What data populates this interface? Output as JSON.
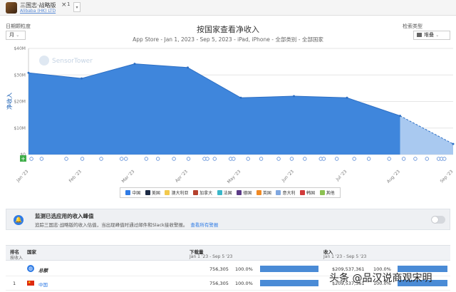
{
  "app": {
    "name": "三国志·战略版",
    "publisher": "Alibaba (HK) LTD",
    "close": "×",
    "count": "1",
    "caret": "▾"
  },
  "controls": {
    "granularity_label": "日期颗粒度",
    "granularity_value": "月",
    "view_label": "检索类型",
    "view_value": "堆叠"
  },
  "chart_data": {
    "type": "area",
    "title": "按国家查看净收入",
    "subtitle": "App Store - Jan 1, 2023 - Sep 5, 2023 - iPad, iPhone - 全部类别 - 全部国家",
    "ylabel": "净收入",
    "yticks": [
      "$0",
      "$10M",
      "$20M",
      "$30M",
      "$40M"
    ],
    "ylim": [
      0,
      40
    ],
    "unit": "$M",
    "categories": [
      "Jan '23",
      "Feb '23",
      "Mar '23",
      "Apr '23",
      "May '23",
      "Jun '23",
      "Jul '23",
      "Aug '23",
      "Sep '23"
    ],
    "series": [
      {
        "name": "中国",
        "values": [
          30.8,
          28.7,
          34.2,
          32.8,
          21.4,
          22.0,
          21.4,
          14.6,
          4.0
        ],
        "projected_from_index": 7
      }
    ],
    "watermark": "SensorTower",
    "grid": true,
    "legend_position": "bottom"
  },
  "colors": {
    "series_fill": "#3f86dc",
    "series_stroke": "#2d6fc4",
    "projected_fill": "#a9c9f0"
  },
  "legend": [
    {
      "name": "中国",
      "color": "#2f7be5"
    },
    {
      "name": "美国",
      "color": "#1c2a44"
    },
    {
      "name": "澳大利亚",
      "color": "#f2c94c"
    },
    {
      "name": "加拿大",
      "color": "#b5412d"
    },
    {
      "name": "法国",
      "color": "#3bb7c9"
    },
    {
      "name": "德国",
      "color": "#5b3a86"
    },
    {
      "name": "英国",
      "color": "#f08a24"
    },
    {
      "name": "意大利",
      "color": "#7fa7e0"
    },
    {
      "name": "韩国",
      "color": "#d13b3b"
    },
    {
      "name": "其他",
      "color": "#8cc152"
    }
  ],
  "alert": {
    "title": "监测已选应用的收入峰值",
    "body": "追踪三国志·战略版的收入估值，当出现峰值时通过邮件和Slack接收警报。",
    "link": "查看所有警报"
  },
  "table": {
    "col_rank": "排名",
    "col_rank_sub": "按收入",
    "col_country": "国家",
    "col_downloads": "下载量",
    "col_downloads_sub": "Jan 1 '23 - Sep 5 '23",
    "col_revenue": "收入",
    "col_revenue_sub": "Jan 1 '23 - Sep 5 '23",
    "rows": [
      {
        "rank": "",
        "country": "总额",
        "downloads": "756,305",
        "dl_pct": "100.0%",
        "revenue": "$209,537,361",
        "rev_pct": "100.0%",
        "dl_share": 1.0,
        "rev_share": 1.0
      },
      {
        "rank": "1",
        "country": "中国",
        "downloads": "756,305",
        "dl_pct": "100.0%",
        "revenue": "$209,537,361",
        "rev_pct": "100.0%",
        "dl_share": 1.0,
        "rev_share": 1.0
      }
    ]
  },
  "watermark_text": "头条 @品汉说商观宋明"
}
